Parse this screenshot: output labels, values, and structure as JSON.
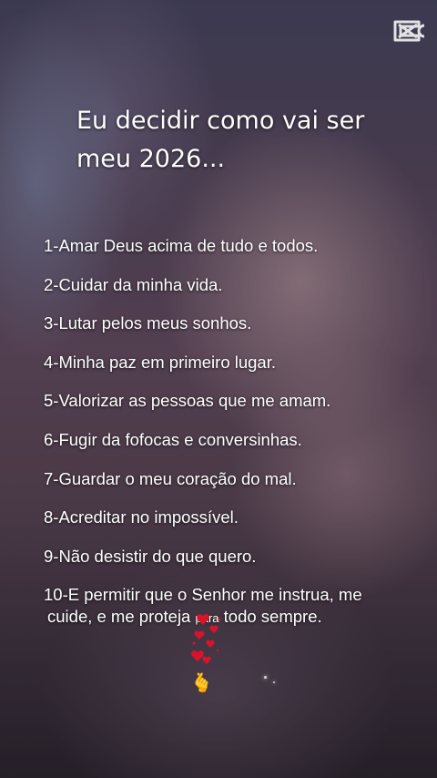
{
  "title": {
    "line1": "Eu decidir como vai ser",
    "line2": "meu 2026..."
  },
  "items": [
    "1-Amar Deus acima de tudo e todos.",
    "2-Cuidar da minha vida.",
    "3-Lutar pelos meus sonhos.",
    "4-Minha paz em primeiro lugar.",
    "5-Valorizar as pessoas que me amam.",
    "6-Fugir da fofocas e conversinhas.",
    "7-Guardar o meu coração do mal.",
    "8-Acreditar no impossível.",
    "9-Não desistir do que quero."
  ],
  "last_item": {
    "line1": "10-E permitir que o Senhor me instrua, me",
    "line2_start": "cuide, e me proteja",
    "line2_small": "para",
    "line2_end": "todo sempre."
  },
  "icons": {
    "logo": "capcut-logo-icon",
    "hearts": "hearts-sticker-icon",
    "hand": "finger-heart-hand-icon"
  },
  "hand_emoji": "🫰",
  "colors": {
    "text": "#ffffff",
    "hearts": "#d8142a"
  }
}
